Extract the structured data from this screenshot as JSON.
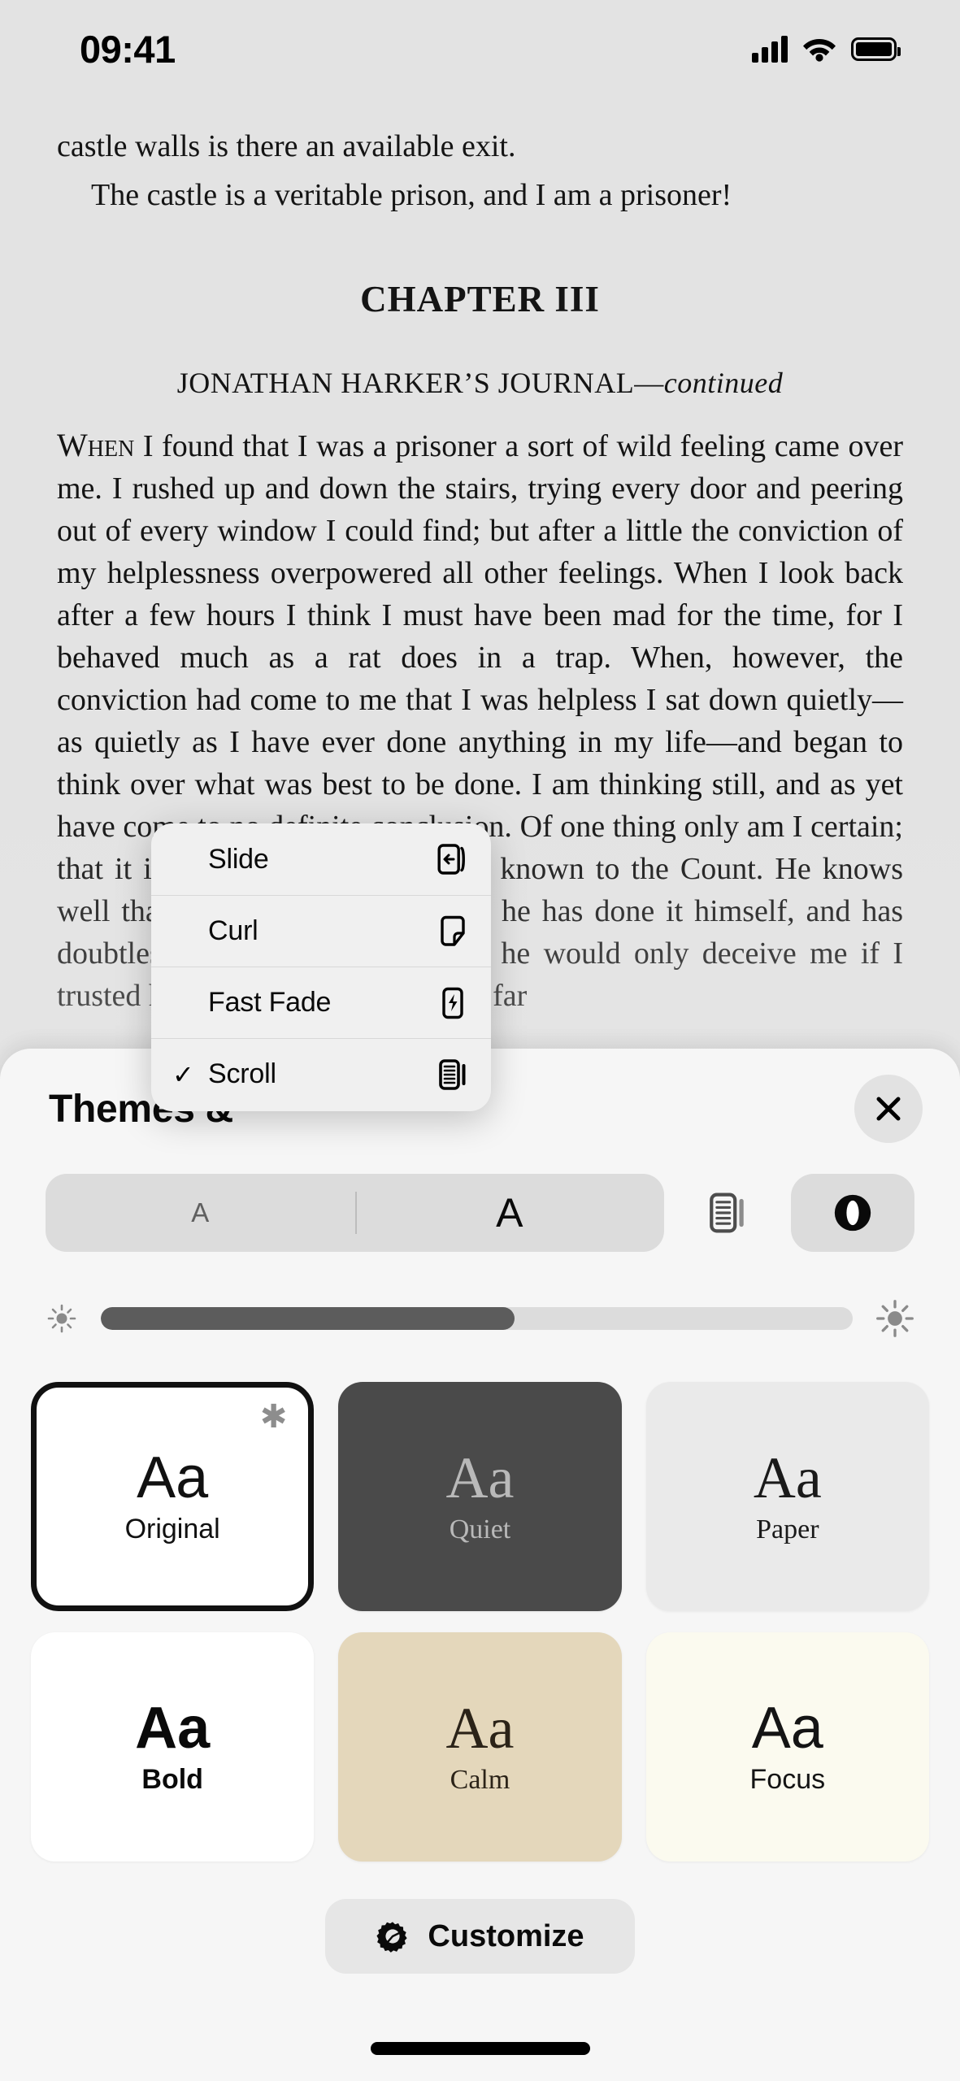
{
  "statusbar": {
    "time": "09:41",
    "cellular_icon": "signal-bars-icon",
    "wifi_icon": "wifi-icon",
    "battery_icon": "battery-icon"
  },
  "book": {
    "line_top_1": "castle walls is there an available exit.",
    "line_top_2": "The castle is a veritable prison, and I am a prisoner!",
    "chapter_title": "CHAPTER III",
    "journal_main": "JONATHAN HARKER’S JOURNAL—",
    "journal_italic": "continued",
    "drop_word": "When",
    "paragraph": " I found that I was a prisoner a sort of wild feeling came over me. I rushed up and down the stairs, trying every door and peering out of every window I could find; but after a little the conviction of my helplessness overpowered all other feelings. When I look back after a few hours I think I must have been mad for the time, for I behaved much as a rat does in a trap. When, however, the conviction had come to me that I was helpless I sat down quietly—as quietly as I have ever done anything in my life—and began to think over what was best to be done. I am thinking still, and as yet have come to no definite conclusion. Of one thing only am I certain; that it is no use making my ideas known to the Count. He knows well that I am imprisoned; and as he has done it himself, and has doubtless his own motives for it, he would only deceive me if I trusted him fully with the facts. So far"
  },
  "popup": {
    "name": "page-transition-menu",
    "items": [
      {
        "label": "Slide",
        "icon": "page-slide-icon",
        "selected": false
      },
      {
        "label": "Curl",
        "icon": "page-curl-icon",
        "selected": false
      },
      {
        "label": "Fast Fade",
        "icon": "page-fast-fade-icon",
        "selected": false
      },
      {
        "label": "Scroll",
        "icon": "page-scroll-icon",
        "selected": true
      }
    ],
    "check_glyph": "✓"
  },
  "sheet": {
    "title": "Themes &",
    "close_icon": "close-icon",
    "font_size_control": {
      "small_label": "A",
      "large_label": "A"
    },
    "layout_button_icon": "scroll-layout-icon",
    "contrast_button_icon": "contrast-icon",
    "brightness": {
      "min_icon": "sun-small-icon",
      "max_icon": "sun-large-icon",
      "value_percent": 55
    },
    "themes": [
      {
        "name": "Original",
        "aa": "Aa",
        "bg": "#ffffff",
        "fg": "#111111",
        "serif": false,
        "bold": false,
        "selected": true,
        "badge": "✱"
      },
      {
        "name": "Quiet",
        "aa": "Aa",
        "bg": "#4a4a4a",
        "fg": "#b9b9b9",
        "serif": true,
        "bold": false,
        "selected": false,
        "badge": ""
      },
      {
        "name": "Paper",
        "aa": "Aa",
        "bg": "#eaeaea",
        "fg": "#1a1a1a",
        "serif": true,
        "bold": false,
        "selected": false,
        "badge": ""
      },
      {
        "name": "Bold",
        "aa": "Aa",
        "bg": "#ffffff",
        "fg": "#0a0a0a",
        "serif": false,
        "bold": true,
        "selected": false,
        "badge": ""
      },
      {
        "name": "Calm",
        "aa": "Aa",
        "bg": "#e4d7bb",
        "fg": "#2b2318",
        "serif": true,
        "bold": false,
        "selected": false,
        "badge": ""
      },
      {
        "name": "Focus",
        "aa": "Aa",
        "bg": "#fbfaef",
        "fg": "#141414",
        "serif": false,
        "bold": false,
        "selected": false,
        "badge": ""
      }
    ],
    "customize": {
      "label": "Customize",
      "icon": "gear-icon"
    }
  },
  "home_indicator": "home-indicator"
}
